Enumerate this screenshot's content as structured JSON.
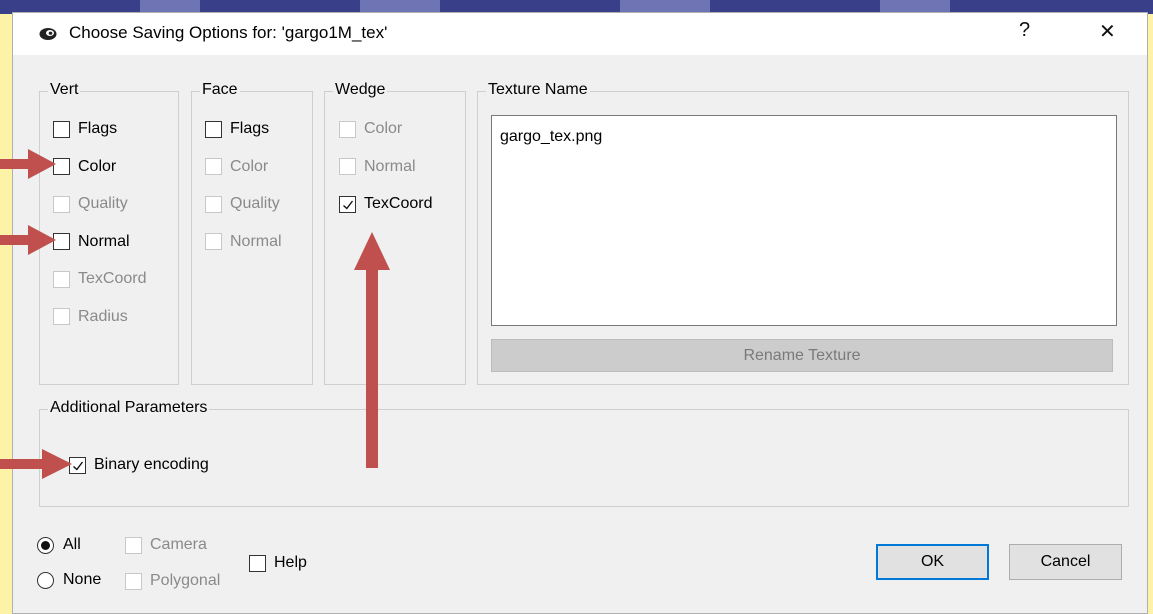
{
  "window": {
    "title": "Choose Saving Options for: 'gargo1M_tex'",
    "help_glyph": "?",
    "close_glyph": "✕"
  },
  "vert": {
    "label": "Vert",
    "items": [
      {
        "label": "Flags",
        "checked": false,
        "enabled": true
      },
      {
        "label": "Color",
        "checked": false,
        "enabled": true
      },
      {
        "label": "Quality",
        "checked": false,
        "enabled": false
      },
      {
        "label": "Normal",
        "checked": false,
        "enabled": true
      },
      {
        "label": "TexCoord",
        "checked": false,
        "enabled": false
      },
      {
        "label": "Radius",
        "checked": false,
        "enabled": false
      }
    ]
  },
  "face": {
    "label": "Face",
    "items": [
      {
        "label": "Flags",
        "checked": false,
        "enabled": true
      },
      {
        "label": "Color",
        "checked": false,
        "enabled": false
      },
      {
        "label": "Quality",
        "checked": false,
        "enabled": false
      },
      {
        "label": "Normal",
        "checked": false,
        "enabled": false
      }
    ]
  },
  "wedge": {
    "label": "Wedge",
    "items": [
      {
        "label": "Color",
        "checked": false,
        "enabled": false
      },
      {
        "label": "Normal",
        "checked": false,
        "enabled": false
      },
      {
        "label": "TexCoord",
        "checked": true,
        "enabled": true
      }
    ]
  },
  "texture": {
    "label": "Texture Name",
    "value": "gargo_tex.png",
    "rename_label": "Rename Texture"
  },
  "additional": {
    "label": "Additional Parameters",
    "binary_label": "Binary encoding",
    "binary_checked": true
  },
  "bottom": {
    "all_label": "All",
    "none_label": "None",
    "selected": "All",
    "camera_label": "Camera",
    "polygonal_label": "Polygonal",
    "help_label": "Help",
    "ok_label": "OK",
    "cancel_label": "Cancel"
  },
  "colors": {
    "annotation_arrow": "#c0504d",
    "background": "#fdf3a6",
    "dialog": "#f0f0f0",
    "ok_border": "#0078d7"
  }
}
